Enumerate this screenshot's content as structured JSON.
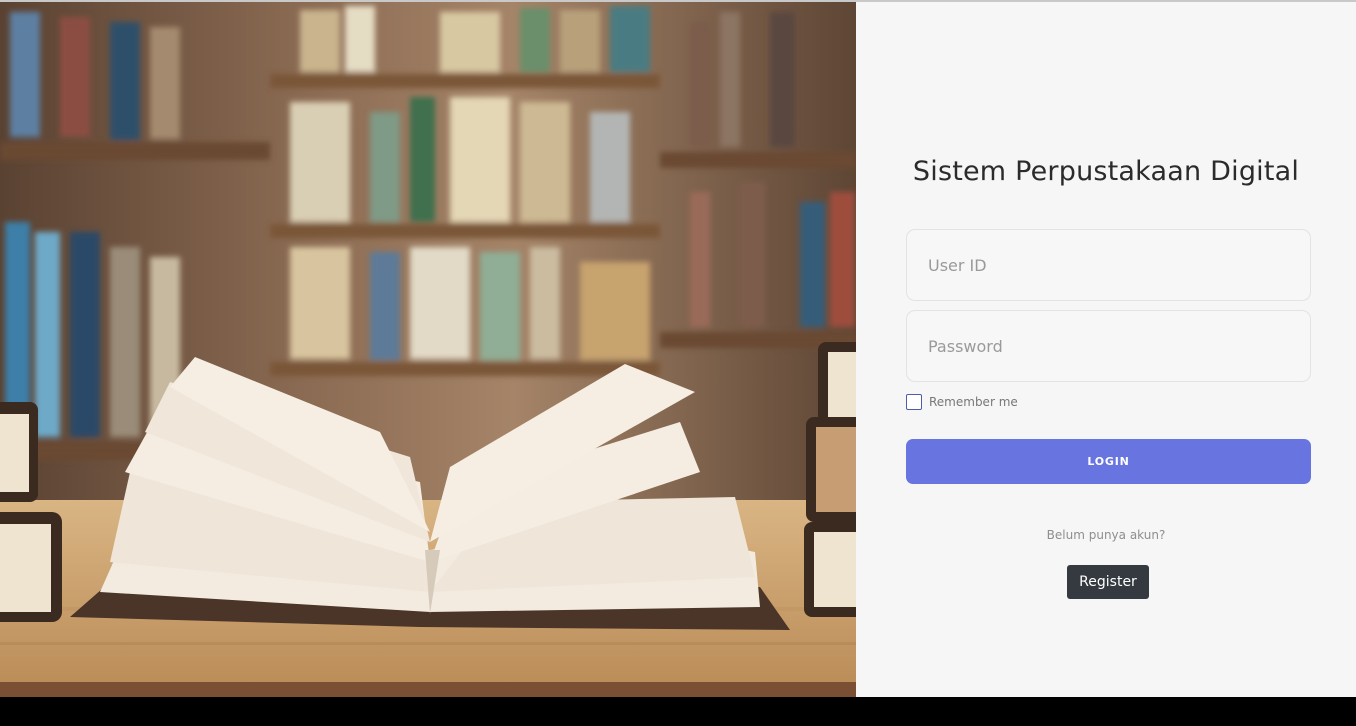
{
  "login": {
    "title": "Sistem Perpustakaan Digital",
    "user_id_placeholder": "User ID",
    "password_placeholder": "Password",
    "remember_label": "Remember me",
    "remember_checked": false,
    "login_label": "LOGIN",
    "no_account_text": "Belum punya akun?",
    "register_label": "Register"
  },
  "colors": {
    "panel_bg": "#f6f6f6",
    "login_button": "#6875e0",
    "register_button": "#343a40",
    "checkbox_border": "#4e5da8"
  }
}
